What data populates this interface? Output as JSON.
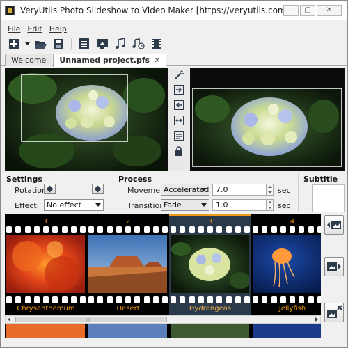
{
  "window": {
    "title": "VeryUtils Photo Slideshow to Video Maker [https://veryutils.com]",
    "controls": {
      "minimize": "—",
      "maximize": "▢",
      "close": "✕"
    }
  },
  "menu": {
    "items": [
      "File",
      "Edit",
      "Help"
    ]
  },
  "toolbar": {
    "icons": [
      "new-project-icon",
      "dropdown-arrow-icon",
      "open-folder-icon",
      "save-icon",
      "properties-icon",
      "export-video-icon",
      "music-icon",
      "music-timer-icon",
      "film-icon"
    ]
  },
  "tabs": [
    {
      "label": "Welcome",
      "active": false
    },
    {
      "label": "Unnamed project.pfs",
      "active": true,
      "close": "✕"
    }
  ],
  "settings": {
    "section_title": "Settings",
    "rotation_label": "Rotation:",
    "effect_label": "Effect:",
    "effect_value": "No effect"
  },
  "process": {
    "section_title": "Process",
    "movement_label": "Movement:",
    "movement_value": "Accelerated",
    "movement_duration": "7.0",
    "movement_unit": "sec",
    "transition_label": "Transition:",
    "transition_value": "Fade",
    "transition_duration": "1.0",
    "transition_unit": "sec"
  },
  "subtitle": {
    "section_title": "Subtitle"
  },
  "filmstrip": {
    "selected_index": 2,
    "frames": [
      {
        "number": "1",
        "name": "Chrysanthemum"
      },
      {
        "number": "2",
        "name": "Desert"
      },
      {
        "number": "3",
        "name": "Hydrangeas"
      },
      {
        "number": "4",
        "name": "Jellyfish"
      }
    ]
  },
  "scrollbar": {
    "grip": "III"
  },
  "colors": {
    "accent": "#f29a16",
    "selected_frame_bg": "#2b3a4a",
    "film_bg": "#000000"
  }
}
